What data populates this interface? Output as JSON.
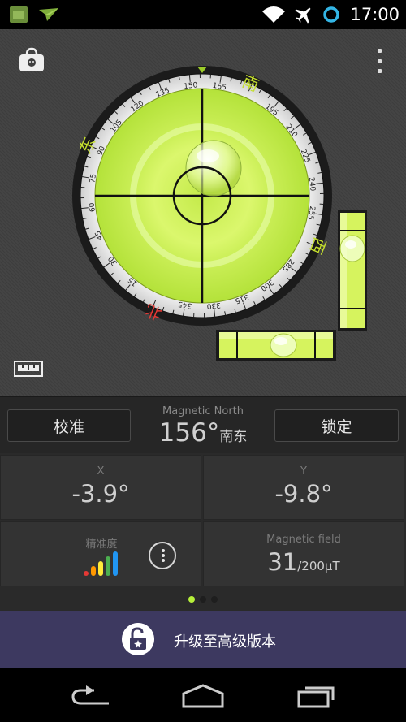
{
  "status_bar": {
    "time": "17:00",
    "icons": [
      "minecraft-app-icon",
      "paper-plane-icon",
      "wifi-icon",
      "airplane-mode-icon",
      "sync-circle-icon"
    ]
  },
  "toolbar": {
    "shop_icon": "shopping-bag-icon",
    "menu_icon": "overflow-menu-icon"
  },
  "compass": {
    "ticks": [
      "135",
      "150",
      "165",
      "195",
      "210",
      "225",
      "240",
      "255",
      "285",
      "300",
      "315",
      "330",
      "345",
      "15",
      "30",
      "45",
      "60",
      "75",
      "90",
      "105",
      "120"
    ],
    "cardinals": {
      "south": "南",
      "east": "东",
      "west": "西",
      "north": "北"
    },
    "heading_deg": 156
  },
  "controls": {
    "calibrate_label": "校准",
    "lock_label": "锁定",
    "ruler_icon": "ruler-icon"
  },
  "magnetic_north": {
    "label": "Magnetic North",
    "degrees": "156°",
    "direction": "南东"
  },
  "tilt": {
    "x_label": "X",
    "x_value": "-3.9°",
    "y_label": "Y",
    "y_value": "-9.8°"
  },
  "accuracy": {
    "label": "精准度",
    "bar_colors": [
      "#e53935",
      "#ff9800",
      "#ffeb3b",
      "#4caf50",
      "#2196f3"
    ]
  },
  "magnetic_field": {
    "label": "Magnetic field",
    "value": "31",
    "unit": "/200µT"
  },
  "pager": {
    "count": 3,
    "active": 0
  },
  "upgrade": {
    "label": "升级至高级版本",
    "icon": "unlock-star-icon"
  },
  "colors": {
    "bubble_green": "#d8f563",
    "banner_purple": "#3d3960",
    "pager_active": "#b6f03a"
  }
}
